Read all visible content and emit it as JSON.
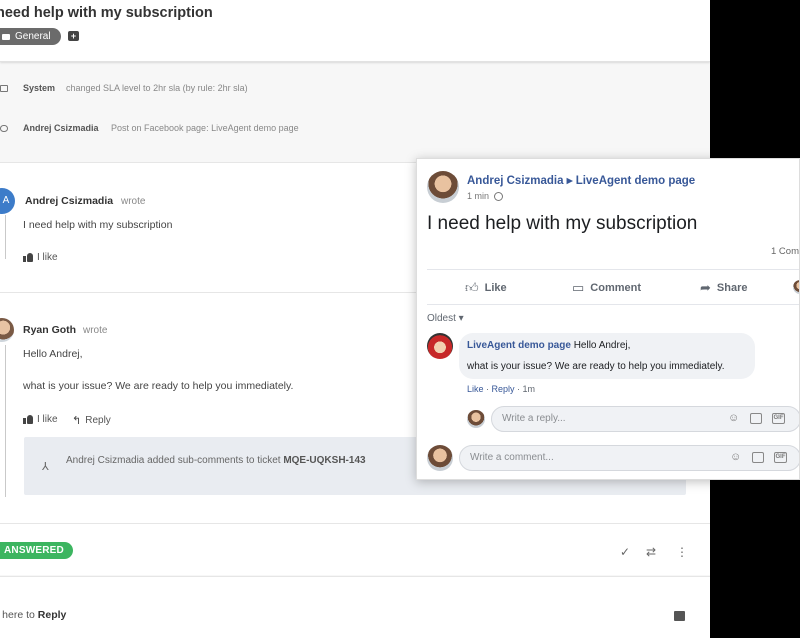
{
  "ticket": {
    "title": "need help with my subscription",
    "tag": "General",
    "tag_add": "+",
    "system_row": {
      "who": "System",
      "what": "changed SLA level to 2hr sla (by rule: 2hr sla)"
    },
    "facebook_row": {
      "who": "Andrej Csizmadia",
      "what": "Post on Facebook page: LiveAgent demo page"
    },
    "message1": {
      "avatar_letter": "A",
      "name": "Andrej Csizmadia",
      "wrote": "wrote",
      "text": "I need help with my subscription",
      "like": "I like"
    },
    "message2": {
      "name": "Ryan Goth",
      "wrote": "wrote",
      "greeting": "Hello Andrej,",
      "text": "what is your issue? We are ready to help you immediately.",
      "like": "I like",
      "reply": "Reply",
      "notice_text": "Andrej Csizmadia added sub-comments to ticket",
      "notice_ticket": "MQE-UQKSH-143"
    },
    "status": "ANSWERED",
    "reply_prefix": "k here to",
    "reply_action": "Reply"
  },
  "facebook": {
    "author": "Andrej Csizmadia",
    "page": "LiveAgent demo page",
    "time": "1 min",
    "post": "I need help with my subscription",
    "comments_count": "1 Com",
    "actions": {
      "like": "Like",
      "comment": "Comment",
      "share": "Share"
    },
    "sort": "Oldest ▾",
    "comment": {
      "author": "LiveAgent demo page",
      "line1": "Hello Andrej,",
      "line2": "what is your issue? We are ready to help you immediately.",
      "like": "Like",
      "reply": "Reply",
      "time": "1m"
    },
    "reply_placeholder": "Write a reply...",
    "comment_placeholder": "Write a comment..."
  }
}
